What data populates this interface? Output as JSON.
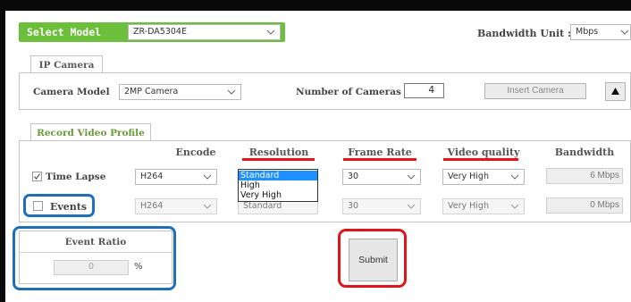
{
  "header": {
    "select_model_label": "Select Model",
    "model_value": "ZR-DA5304E",
    "bandwidth_unit_label": "Bandwidth Unit :",
    "bandwidth_unit_value": "Mbps"
  },
  "ip_camera": {
    "tab_label": "IP Camera",
    "camera_model_label": "Camera Model",
    "camera_model_value": "2MP Camera",
    "num_cameras_label": "Number of Cameras",
    "num_cameras_value": "4",
    "insert_button_label": "Insert Camera",
    "collapse_icon": "triangle-up-icon"
  },
  "record_profile": {
    "tab_label": "Record Video Profile",
    "columns": [
      "Encode",
      "Resolution",
      "Frame Rate",
      "Video quality",
      "Bandwidth"
    ],
    "rows": [
      {
        "label": "Time Lapse",
        "checked": true,
        "encode": "H264",
        "resolution": "Standard",
        "frame_rate": "30",
        "video_quality": "Very High",
        "bandwidth": "6 Mbps"
      },
      {
        "label": "Events",
        "checked": false,
        "encode": "H264",
        "resolution": "Standard",
        "frame_rate": "30",
        "video_quality": "Very High",
        "bandwidth": "0 Mbps"
      }
    ],
    "resolution_options": [
      "Standard",
      "High",
      "Very High"
    ]
  },
  "event_ratio": {
    "title": "Event Ratio",
    "value": "0",
    "unit": "%"
  },
  "submit_label": "Submit",
  "colors": {
    "accent_green": "#6cbf3b",
    "highlight_blue": "#1f6fb8",
    "highlight_red": "#e0151c",
    "selected_option": "#1e90ff"
  }
}
